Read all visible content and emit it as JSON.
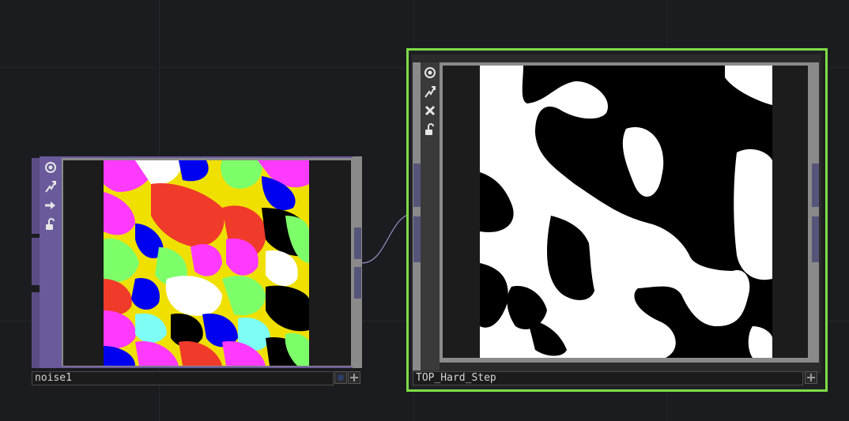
{
  "nodes": {
    "noise": {
      "name": "noise1",
      "icons": [
        "viewer-active-icon",
        "cook-icon",
        "bypass-icon",
        "lock-icon"
      ]
    },
    "hardstep": {
      "name": "TOP_Hard_Step",
      "icons": [
        "viewer-active-icon",
        "cook-icon",
        "close-icon",
        "lock-icon"
      ]
    }
  },
  "colors": {
    "background": "#1b1c20",
    "operator_family_top": "#6a5a9c",
    "selection_outline": "#7ddc48",
    "wire": "#9a8fc4"
  }
}
